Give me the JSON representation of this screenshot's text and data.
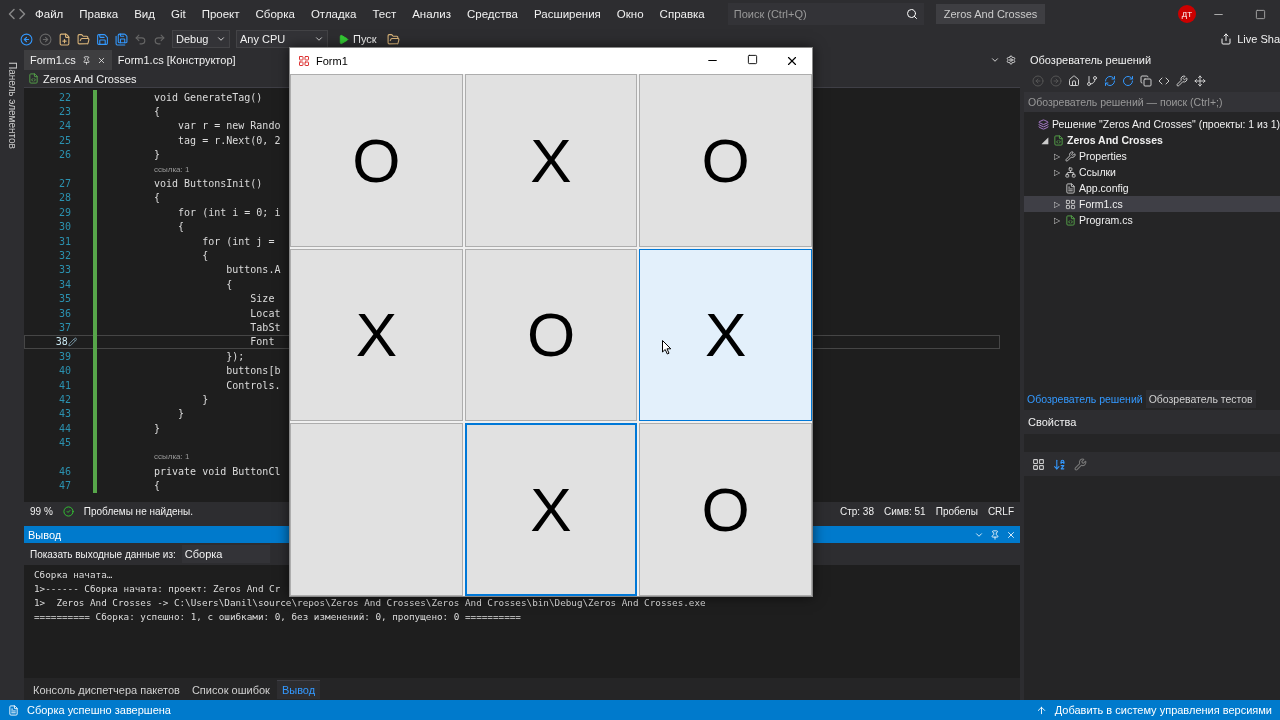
{
  "menu": {
    "items": [
      "Файл",
      "Правка",
      "Вид",
      "Git",
      "Проект",
      "Сборка",
      "Отладка",
      "Тест",
      "Анализ",
      "Средства",
      "Расширения",
      "Окно",
      "Справка"
    ],
    "search_placeholder": "Поиск (Ctrl+Q)",
    "solution_name": "Zeros And Crosses",
    "avatar": "ДТ"
  },
  "toolbar": {
    "configuration": "Debug",
    "platform": "Any CPU",
    "run": "Пуск",
    "live_share": "Live Sha"
  },
  "left_strip": {
    "label": "Панель элементов"
  },
  "editor": {
    "tabs": [
      {
        "label": "Form1.cs",
        "selected": true
      },
      {
        "label": "Form1.cs [Конструктор]",
        "selected": false
      }
    ],
    "nav": "Zeros And Crosses",
    "lines": [
      {
        "kind": "code",
        "number": "22",
        "text": "void GenerateTag()",
        "current": false
      },
      {
        "kind": "code",
        "number": "23",
        "text": "{",
        "current": false
      },
      {
        "kind": "code",
        "number": "24",
        "text": "    var r = new Rando",
        "current": false
      },
      {
        "kind": "code",
        "number": "25",
        "text": "    tag = r.Next(0, 2",
        "current": false
      },
      {
        "kind": "code",
        "number": "26",
        "text": "}",
        "current": false
      },
      {
        "kind": "lens",
        "text": "ссылка: 1"
      },
      {
        "kind": "code",
        "number": "27",
        "text": "void ButtonsInit()",
        "current": false
      },
      {
        "kind": "code",
        "number": "28",
        "text": "{",
        "current": false
      },
      {
        "kind": "code",
        "number": "29",
        "text": "    for (int i = 0; i",
        "current": false
      },
      {
        "kind": "code",
        "number": "30",
        "text": "    {",
        "current": false
      },
      {
        "kind": "code",
        "number": "31",
        "text": "        for (int j =",
        "current": false
      },
      {
        "kind": "code",
        "number": "32",
        "text": "        {",
        "current": false
      },
      {
        "kind": "code",
        "number": "33",
        "text": "            buttons.A",
        "current": false
      },
      {
        "kind": "code",
        "number": "34",
        "text": "            {",
        "current": false
      },
      {
        "kind": "code",
        "number": "35",
        "text": "                Size",
        "current": false
      },
      {
        "kind": "code",
        "number": "36",
        "text": "                Locat",
        "current": false
      },
      {
        "kind": "code",
        "number": "37",
        "text": "                TabSt",
        "current": false
      },
      {
        "kind": "code",
        "number": "38",
        "text": "                Font",
        "current": true
      },
      {
        "kind": "code",
        "number": "39",
        "text": "            });",
        "current": false
      },
      {
        "kind": "code",
        "number": "40",
        "text": "            buttons[b",
        "current": false
      },
      {
        "kind": "code",
        "number": "41",
        "text": "            Controls.",
        "current": false
      },
      {
        "kind": "code",
        "number": "42",
        "text": "        }",
        "current": false
      },
      {
        "kind": "code",
        "number": "43",
        "text": "    }",
        "current": false
      },
      {
        "kind": "code",
        "number": "44",
        "text": "}",
        "current": false
      },
      {
        "kind": "code",
        "number": "45",
        "current": false
      },
      {
        "kind": "lens",
        "text": "ссылка: 1"
      },
      {
        "kind": "code",
        "number": "46",
        "text": "private void ButtonCl",
        "current": false
      },
      {
        "kind": "code",
        "number": "47",
        "text": "{",
        "current": false
      }
    ],
    "status": {
      "zoom": "99 %",
      "problems": "Проблемы не найдены.",
      "line": "Стр: 38",
      "column": "Симв: 51",
      "indent": "Пробелы",
      "eol": "CRLF"
    }
  },
  "output": {
    "title": "Вывод",
    "source_label": "Показать выходные данные из:",
    "source": "Сборка",
    "lines": [
      "Сборка начата…",
      "1>------ Сборка начата: проект: Zeros And Cr",
      "1>  Zeros And Crosses -> C:\\Users\\Danil\\source\\repos\\Zeros And Crosses\\Zeros And Crosses\\bin\\Debug\\Zeros And Crosses.exe",
      "========== Сборка: успешно: 1, с ошибками: 0, без изменений: 0, пропущено: 0 =========="
    ],
    "tabs": [
      {
        "label": "Консоль диспетчера пакетов",
        "selected": false
      },
      {
        "label": "Список ошибок",
        "selected": false
      },
      {
        "label": "Вывод",
        "selected": true
      }
    ]
  },
  "solution_explorer": {
    "title": "Обозреватель решений",
    "search_placeholder": "Обозреватель решений — поиск (Ctrl+;)",
    "tree": [
      {
        "label": "Решение \"Zeros And Crosses\" (проекты: 1 из 1)",
        "kind": "solution",
        "selected": false,
        "children": [
          {
            "label": "Zeros And Crosses",
            "kind": "project",
            "expander": "◢",
            "selected": false,
            "children": [
              {
                "label": "Properties",
                "kind": "properties",
                "expander": "▷",
                "selected": false
              },
              {
                "label": "Ссылки",
                "kind": "references",
                "expander": "▷",
                "selected": false
              },
              {
                "label": "App.config",
                "kind": "config",
                "selected": false
              },
              {
                "label": "Form1.cs",
                "kind": "form",
                "expander": "▷",
                "selected": true
              },
              {
                "label": "Program.cs",
                "kind": "csharp",
                "expander": "▷",
                "selected": false
              }
            ]
          }
        ]
      }
    ],
    "tabs": [
      {
        "label": "Обозреватель решений",
        "selected": true
      },
      {
        "label": "Обозреватель тестов",
        "selected": false
      }
    ]
  },
  "properties": {
    "title": "Свойства"
  },
  "status_bar": {
    "message": "Сборка успешно завершена",
    "action": "Добавить в систему управления версиями"
  },
  "form": {
    "title": "Form1",
    "cells": [
      {
        "text": "O",
        "hovered": false,
        "focused": false
      },
      {
        "text": "X",
        "hovered": false,
        "focused": false
      },
      {
        "text": "O",
        "hovered": false,
        "focused": false
      },
      {
        "text": "X",
        "hovered": false,
        "focused": false
      },
      {
        "text": "O",
        "hovered": false,
        "focused": false
      },
      {
        "text": "X",
        "hovered": true,
        "focused": false
      },
      {
        "hovered": false,
        "focused": false
      },
      {
        "text": "X",
        "hovered": false,
        "focused": true
      },
      {
        "text": "O",
        "hovered": false,
        "focused": false
      }
    ]
  }
}
